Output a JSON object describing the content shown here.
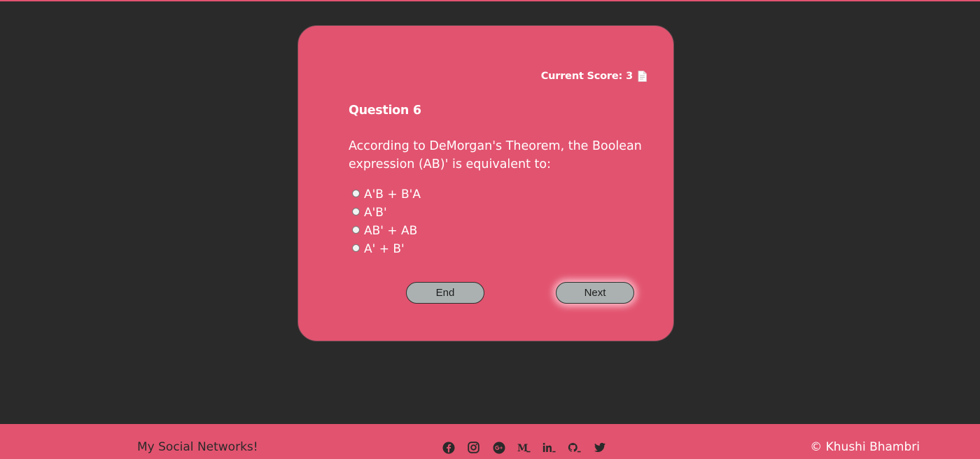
{
  "quiz": {
    "score_label": "Current Score:",
    "score_value": "3",
    "score_icon": "document-icon",
    "question_title": "Question 6",
    "question_text": "According to DeMorgan's Theorem, the Boolean expression (AB)' is equivalent to:",
    "options": [
      {
        "label": "A'B + B'A"
      },
      {
        "label": "A'B'"
      },
      {
        "label": "AB' + AB"
      },
      {
        "label": "A' + B'"
      }
    ],
    "end_label": "End",
    "next_label": "Next"
  },
  "footer": {
    "left_text": "My Social Networks!",
    "right_text": "© Khushi Bhambri",
    "social_icons": [
      "facebook-icon",
      "instagram-icon",
      "google-plus-icon",
      "medium-icon",
      "linkedin-icon",
      "github-icon",
      "twitter-icon"
    ]
  },
  "colors": {
    "background": "#2a2a2a",
    "accent": "#e2536f",
    "button": "#aab1b0",
    "text_light": "#ffffff",
    "text_dark": "#2a2a2a"
  }
}
